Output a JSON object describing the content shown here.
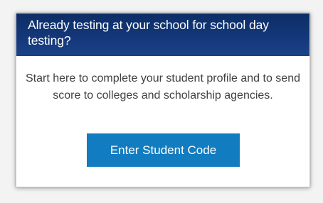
{
  "card": {
    "header_title": "Already testing at your school for school day testing?",
    "description": "Start here to complete your student profile and to send score to colleges and scholarship agencies.",
    "button_label": "Enter Student Code"
  },
  "colors": {
    "header_bg": "#0c2d66",
    "button_bg": "#127cc0",
    "body_text": "#404040"
  }
}
